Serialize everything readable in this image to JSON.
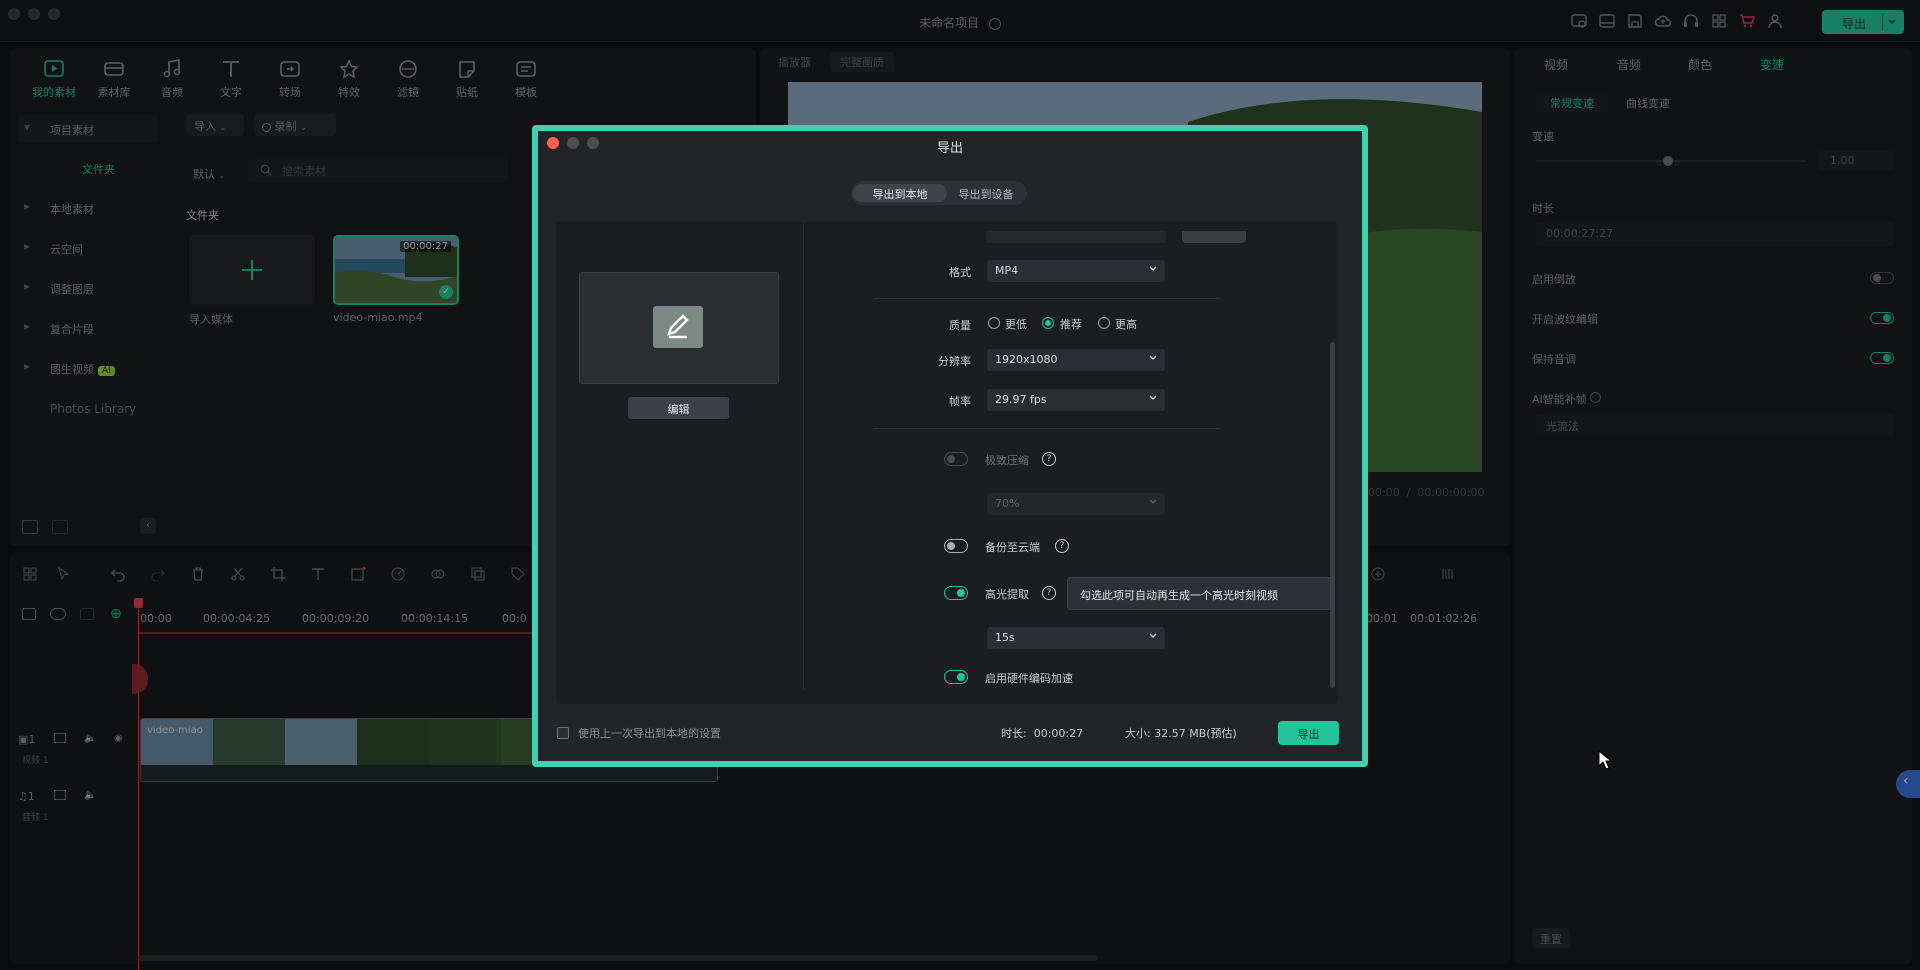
{
  "app": {
    "title": "未命名项目",
    "top_export": "导出"
  },
  "media": {
    "tabs": [
      {
        "label": "我的素材",
        "icon": "my-media-icon"
      },
      {
        "label": "素材库",
        "icon": "library-icon"
      },
      {
        "label": "音频",
        "icon": "audio-icon"
      },
      {
        "label": "文字",
        "icon": "text-icon"
      },
      {
        "label": "转场",
        "icon": "transition-icon"
      },
      {
        "label": "特效",
        "icon": "effects-icon"
      },
      {
        "label": "滤镜",
        "icon": "filter-icon"
      },
      {
        "label": "贴纸",
        "icon": "sticker-icon"
      },
      {
        "label": "模板",
        "icon": "template-icon"
      }
    ],
    "tree": [
      "项目素材",
      "本地素材",
      "云空间",
      "调整图层",
      "复合片段",
      "图生视频"
    ],
    "tree_folder": "文件夹",
    "tree_ai_badge": "AI",
    "photos_library": "Photos Library",
    "import_label": "导入",
    "record_label": "录制",
    "sort_label": "默认",
    "search_placeholder": "搜索素材",
    "folder_heading": "文件夹",
    "import_media_label": "导入媒体",
    "clip_name": "video-miao.mp4",
    "clip_duration": "00:00:27"
  },
  "preview": {
    "player_label": "播放器",
    "quality_label": "完整画质",
    "time_current": "00:00",
    "time_total": "00:00:00:00"
  },
  "props": {
    "tabs": [
      "视频",
      "音频",
      "颜色",
      "变速"
    ],
    "subtabs": [
      "常规变速",
      "曲线变速"
    ],
    "speed_label": "变速",
    "speed_value": "1.00",
    "duration_label": "时长",
    "duration_value": "00:00:27:27",
    "reverse_label": "启用倒放",
    "ripple_label": "开启波纹编辑",
    "keep_pitch_label": "保持音调",
    "ai_frame_label": "AI智能补帧",
    "ai_frame_value": "光流法",
    "reset_label": "重置"
  },
  "timeline": {
    "ruler": [
      "00:00",
      "00:00:04:25",
      "00:00:09:20",
      "00:00:14:15",
      "00:0",
      "00:01",
      "00:01:02:26"
    ],
    "video_track_label": "视频 1",
    "audio_track_label": "音频 1",
    "clip_label": "video-miao"
  },
  "dialog": {
    "title": "导出",
    "tabs": [
      "导出到本地",
      "导出到设备"
    ],
    "edit_label": "编辑",
    "format_label": "格式",
    "format_value": "MP4",
    "quality_label": "质量",
    "quality_options": [
      "更低",
      "推荐",
      "更高"
    ],
    "resolution_label": "分辨率",
    "resolution_value": "1920x1080",
    "framerate_label": "帧率",
    "framerate_value": "29.97 fps",
    "compress_label": "极致压缩",
    "compress_value": "70%",
    "cloud_label": "备份至云端",
    "highlight_label": "高光提取",
    "highlight_value": "15s",
    "highlight_tooltip": "勾选此项可自动再生成一个高光时刻视频",
    "hw_label": "启用硬件编码加速",
    "use_last_label": "使用上一次导出到本地的设置",
    "duration_label": "时长:",
    "duration_value": "00:00:27",
    "size_label": "大小:",
    "size_value": "32.57 MB(预估)",
    "export_label": "导出"
  },
  "colors": {
    "accent": "#24c49a",
    "dialog_border": "#3fd2b1",
    "close_red": "#ff5f57"
  }
}
